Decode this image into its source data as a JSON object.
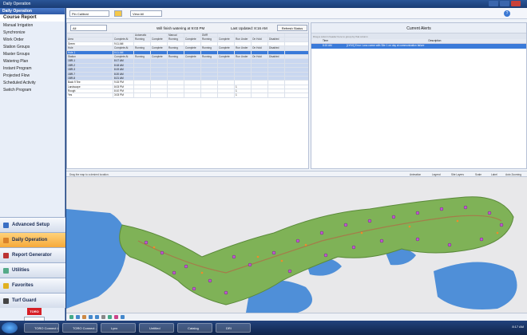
{
  "window": {
    "title": "Daily Operation"
  },
  "sidebar": {
    "header": "Daily Operation",
    "items": [
      {
        "label": "Course Report",
        "active": true
      },
      {
        "label": "Manual Irrigation"
      },
      {
        "label": "Synchronize"
      },
      {
        "label": "Work Order"
      },
      {
        "label": "Station Groups"
      },
      {
        "label": "Master Groups"
      },
      {
        "label": "Watering Plan"
      },
      {
        "label": "Instant Program"
      },
      {
        "label": "Projected Flow"
      },
      {
        "label": "Scheduled Activity"
      },
      {
        "label": "Switch Program"
      }
    ],
    "groups": [
      {
        "label": "Advanced Setup",
        "icon": "gear-icon",
        "color": "#3a6fc4"
      },
      {
        "label": "Daily Operation",
        "icon": "calendar-icon",
        "color": "#d9822b",
        "selected": true
      },
      {
        "label": "Report Generator",
        "icon": "report-icon",
        "color": "#b33"
      },
      {
        "label": "Utilities",
        "icon": "tools-icon",
        "color": "#5a8"
      },
      {
        "label": "Favorites",
        "icon": "star-icon",
        "color": "#e0b020"
      },
      {
        "label": "Turf Guard",
        "icon": "flag-icon",
        "color": "#444"
      }
    ],
    "logo_text": "TORO"
  },
  "toolbar": {
    "select1": "Pin Calibrat",
    "select2": "View All"
  },
  "grid": {
    "filter": "All",
    "status_message": "Will finish watering at 9:03 PM",
    "last_updated": "Last Updated: 8:16 AM",
    "refresh_label": "Refresh Status",
    "group_headers": [
      "Automatic",
      "Manual",
      "DMR"
    ],
    "col_headers": [
      "Area",
      "Complete At",
      "Running",
      "Complete",
      "Running",
      "Complete",
      "Running",
      "Complete",
      "Run Under",
      "On Hold",
      "Disabled"
    ],
    "rows": [
      {
        "name": "Green",
        "time": "9:11 AM",
        "type": "area"
      },
      {
        "name": "Hole",
        "time": "Complete At",
        "type": "header"
      },
      {
        "name": "Hole 1",
        "time": "8:11 AM",
        "type": "selected"
      },
      {
        "name": "Station",
        "time": "Complete At",
        "type": "header"
      },
      {
        "name": "1BR-1",
        "time": "8:17 AM",
        "type": "station"
      },
      {
        "name": "1BR-2",
        "time": "8:18 AM",
        "type": "station"
      },
      {
        "name": "1BR-3",
        "time": "8:19 AM",
        "type": "station"
      },
      {
        "name": "1BR-7",
        "time": "8:20 AM",
        "type": "station"
      },
      {
        "name": "1BR-8",
        "time": "8:21 AM",
        "type": "station"
      },
      {
        "name": "Back 9 Tee",
        "time": "9:15 PM",
        "type": "area"
      },
      {
        "name": "Landscape",
        "time": "8:03 PM",
        "type": "area",
        "val": "1"
      },
      {
        "name": "Rough",
        "time": "8:10 PM",
        "type": "area",
        "val": "1"
      },
      {
        "name": "Yes",
        "time": "3:03 PM",
        "type": "area",
        "val": "1"
      }
    ]
  },
  "alerts": {
    "title": "Current Alerts",
    "drag_note": "Drag a column header here to group by that column",
    "columns": [
      "Time",
      "Description"
    ],
    "rows": [
      {
        "time": "8:15 AM",
        "desc": "[LYNX] Error: Loss comm with Site 1 on day at communication failure"
      }
    ]
  },
  "map": {
    "hint": "Drag the map to a desired location.",
    "options": [
      "Animation",
      "Legend",
      "Site Layers",
      "Scale",
      "Label",
      "Auto Zooming"
    ]
  },
  "taskbar": {
    "tasks": [
      "TORO Connect Lig...",
      "TORO Connect - Si...",
      "Lynx",
      "Untitled",
      "Catalog",
      "DRI"
    ],
    "clock": "8:17 AM"
  }
}
